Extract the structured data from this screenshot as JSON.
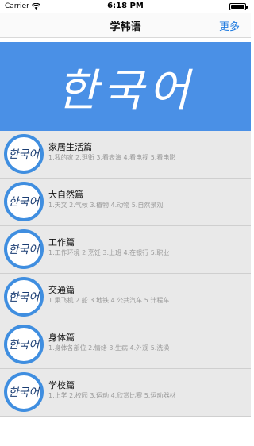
{
  "status_bar": {
    "carrier": "Carrier",
    "time": "6:18 PM",
    "battery_level": 1.0
  },
  "nav": {
    "title": "学韩语",
    "more_label": "更多"
  },
  "banner": {
    "text": "한국어"
  },
  "list": {
    "avatar_text": "한국어",
    "items": [
      {
        "title": "家居生活篇",
        "subtitle": "1.我的家  2.逛街  3.看表演  4.看电视  5.看电影"
      },
      {
        "title": "大自然篇",
        "subtitle": "1.天文  2.气候  3.植物  4.动物  5.自然景观"
      },
      {
        "title": "工作篇",
        "subtitle": "1.工作环境  2.烹饪  3.上班  4.在银行  5.职业"
      },
      {
        "title": "交通篇",
        "subtitle": "1.乘飞机  2.船  3.地铁  4.公共汽车  5.计程车"
      },
      {
        "title": "身体篇",
        "subtitle": "1.身体各部位  2.情绪  3.生病  4.外观  5.洗澡"
      },
      {
        "title": "学校篇",
        "subtitle": "1.上学  2.校园  3.运动  4.欣赏比赛  5.运动器材"
      }
    ]
  },
  "colors": {
    "accent": "#1f7be0",
    "banner_bg": "#4a90e6",
    "avatar_ring": "#3f8ee0",
    "row_bg": "#e9e9e9"
  }
}
